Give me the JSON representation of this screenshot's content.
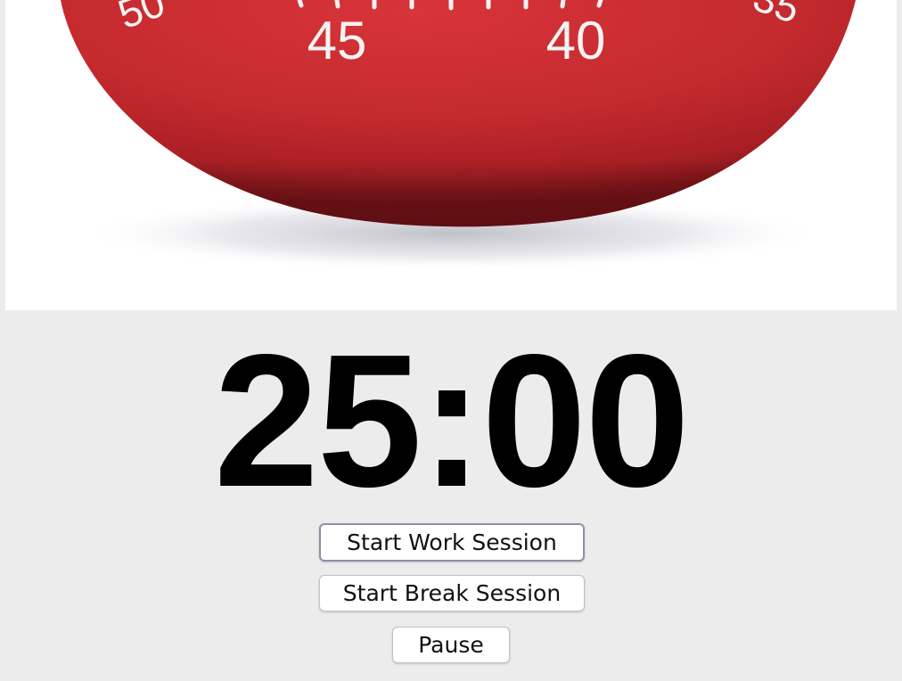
{
  "image": {
    "dial_numbers": [
      "45",
      "40"
    ],
    "dial_partial_left": "50",
    "dial_partial_right": "35",
    "colors": {
      "tomato": "#c42a2e",
      "tomato_dark": "#8f1b1f",
      "numbers": "#f3f3f3"
    }
  },
  "timer": {
    "display": "25:00"
  },
  "buttons": {
    "work_label": "Start Work Session",
    "break_label": "Start Break Session",
    "pause_label": "Pause"
  }
}
